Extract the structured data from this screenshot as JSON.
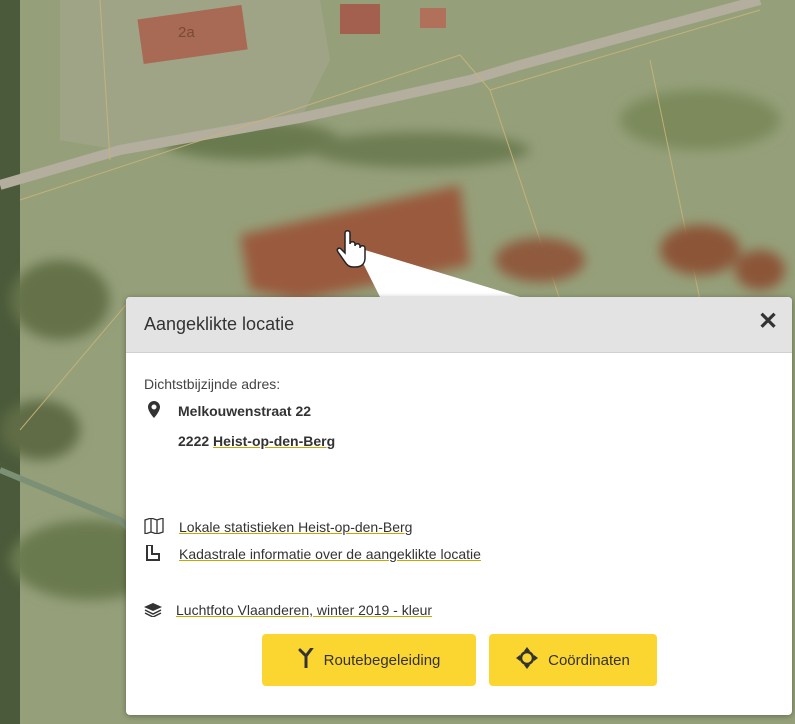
{
  "map": {
    "house_number": "2a",
    "colors": {
      "field": "#9aa27a",
      "soil": "#9a5a3c",
      "road": "#b9b4a3"
    }
  },
  "popup": {
    "title": "Aangeklikte locatie",
    "close_label": "✕",
    "nearest_address_label": "Dichtstbijzijnde adres:",
    "street": "Melkouwenstraat 22",
    "postal_code": "2222",
    "city": "Heist-op-den-Berg",
    "links": {
      "stats": "Lokale statistieken Heist-op-den-Berg",
      "cadastre": "Kadastrale informatie over de aangeklikte locatie",
      "aerial": "Luchtfoto Vlaanderen, winter 2019 - kleur"
    },
    "buttons": {
      "route": "Routebegeleiding",
      "coords": "Coördinaten"
    },
    "accent": "#fcd630",
    "link_underline": "#c6a600",
    "icons": [
      "map-pin-icon",
      "map-book-icon",
      "parcel-icon",
      "layers-icon",
      "route-icon",
      "crosshair-icon"
    ]
  }
}
